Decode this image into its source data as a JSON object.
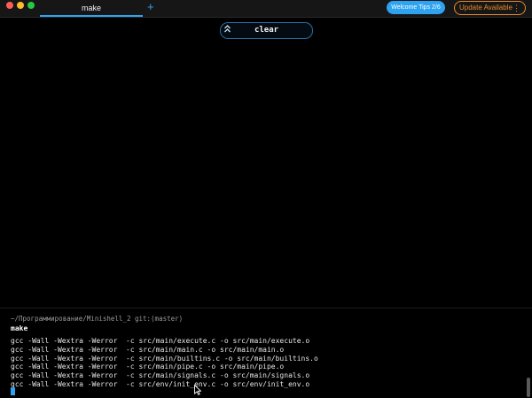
{
  "window": {
    "tab_title": "make",
    "new_tab_symbol": "+",
    "tips_button": "Welcome Tips 2/6",
    "update_button": "Update Available",
    "update_menu_symbol": "⋮"
  },
  "block": {
    "collapse_icon": "double-chevron-up-icon",
    "collapse_symbol": "≈",
    "command_chip": "clear"
  },
  "terminal": {
    "prompt": "~/Программирование/Minishell_2 git:(master)",
    "command": "make",
    "output": [
      "gcc -Wall -Wextra -Werror  -c src/main/execute.c -o src/main/execute.o",
      "gcc -Wall -Wextra -Werror  -c src/main/main.c -o src/main/main.o",
      "gcc -Wall -Wextra -Werror  -c src/main/builtins.c -o src/main/builtins.o",
      "gcc -Wall -Wextra -Werror  -c src/main/pipe.c -o src/main/pipe.o",
      "gcc -Wall -Wextra -Werror  -c src/main/signals.c -o src/main/signals.o",
      "gcc -Wall -Wextra -Werror  -c src/env/init_env.c -o src/env/init_env.o"
    ]
  },
  "colors": {
    "accent": "#2ea3f2",
    "update": "#e88a2a",
    "background": "#000000"
  }
}
